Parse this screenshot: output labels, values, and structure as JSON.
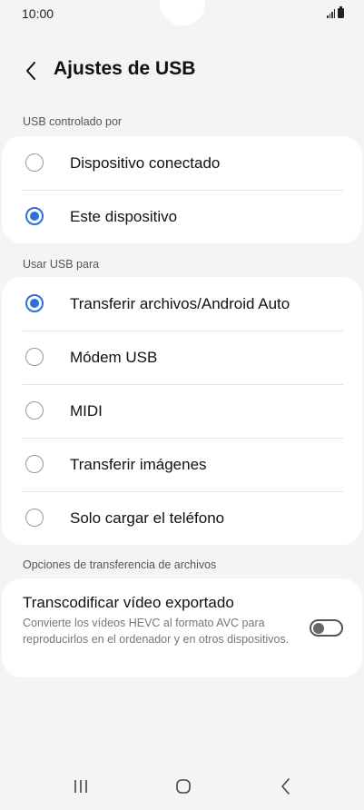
{
  "status_bar": {
    "time": "10:00"
  },
  "header": {
    "title": "Ajustes de USB"
  },
  "usb_controlled_by": {
    "label": "USB controlado por",
    "options": [
      {
        "label": "Dispositivo conectado",
        "selected": false
      },
      {
        "label": "Este dispositivo",
        "selected": true
      }
    ]
  },
  "use_usb_for": {
    "label": "Usar USB para",
    "options": [
      {
        "label": "Transferir archivos/Android Auto",
        "selected": true
      },
      {
        "label": "Módem USB",
        "selected": false
      },
      {
        "label": "MIDI",
        "selected": false
      },
      {
        "label": "Transferir imágenes",
        "selected": false
      },
      {
        "label": "Solo cargar el teléfono",
        "selected": false
      }
    ]
  },
  "file_transfer_options": {
    "label": "Opciones de transferencia de archivos",
    "transcode": {
      "title": "Transcodificar vídeo exportado",
      "description": "Convierte los vídeos HEVC al formato AVC para reproducirlos en el ordenador y en otros dispositivos.",
      "enabled": false
    }
  },
  "colors": {
    "accent": "#2f6fde",
    "background": "#f4f4f6",
    "card": "#ffffff"
  }
}
